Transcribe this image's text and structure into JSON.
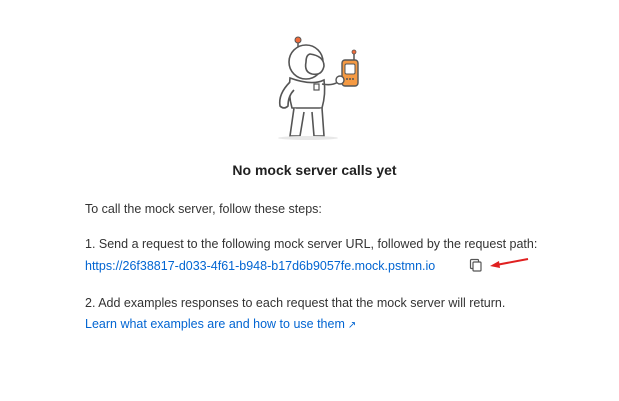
{
  "empty_state": {
    "title": "No mock server calls yet",
    "intro": "To call the mock server, follow these steps:",
    "step1_text": "1. Send a request to the following mock server URL, followed by the request path:",
    "mock_url": "https://26f38817-d033-4f61-b948-b17d6b9057fe.mock.pstmn.io",
    "step2_text": "2. Add examples responses to each request that the mock server will return.",
    "learn_link": "Learn what examples are and how to use them",
    "learn_link_icon": "↗"
  },
  "icons": {
    "copy": "copy-icon",
    "external": "external-link-icon",
    "annotation": "red-arrow-annotation",
    "illustration": "astronaut-with-walkie-talkie"
  },
  "colors": {
    "link": "#0265d2",
    "annotation": "#e02020",
    "accent": "#f26b3a"
  }
}
